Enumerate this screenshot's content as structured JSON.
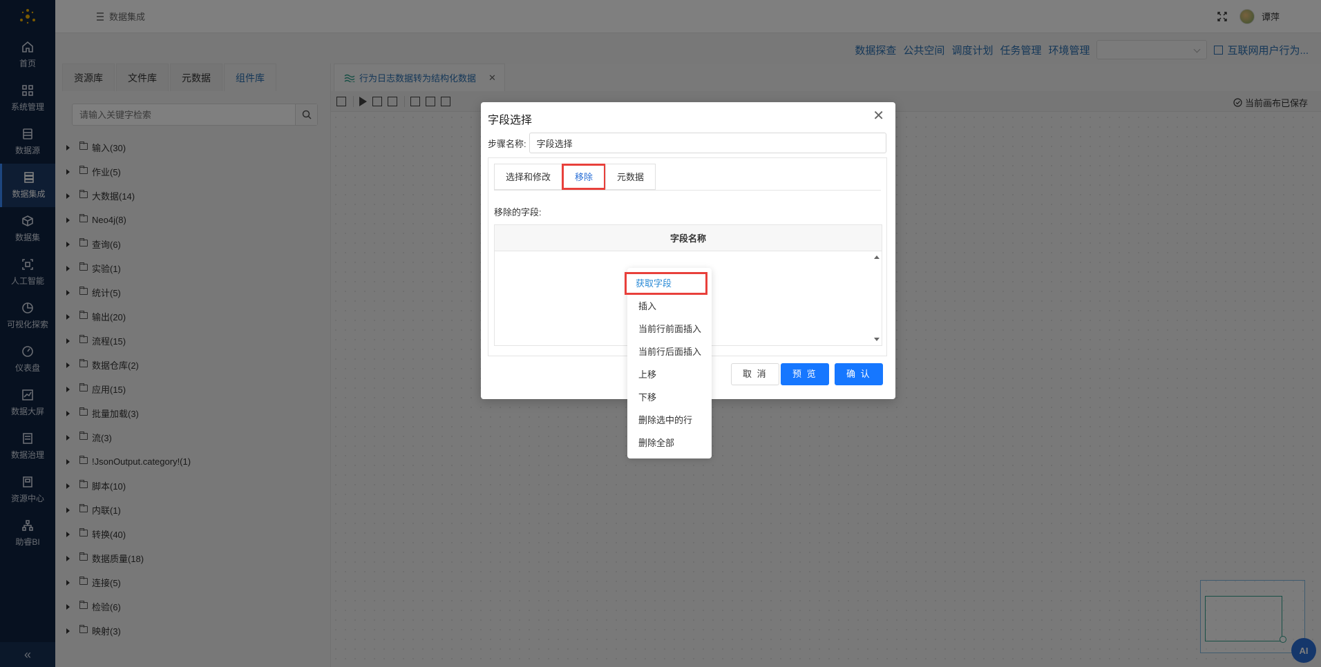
{
  "nav": {
    "items": [
      {
        "label": "首页",
        "icon": "home-icon"
      },
      {
        "label": "系统管理",
        "icon": "grid-icon"
      },
      {
        "label": "数据源",
        "icon": "database-icon"
      },
      {
        "label": "数据集成",
        "icon": "server-icon",
        "active": true
      },
      {
        "label": "数据集",
        "icon": "cube-icon"
      },
      {
        "label": "人工智能",
        "icon": "ai-scan-icon"
      },
      {
        "label": "可视化探索",
        "icon": "pie-chart-icon"
      },
      {
        "label": "仪表盘",
        "icon": "gauge-icon"
      },
      {
        "label": "数据大屏",
        "icon": "line-chart-icon"
      },
      {
        "label": "数据治理",
        "icon": "document-icon"
      },
      {
        "label": "资源中心",
        "icon": "book-icon"
      },
      {
        "label": "助睿BI",
        "icon": "network-icon"
      }
    ],
    "collapse": "«"
  },
  "header": {
    "breadcrumb": "数据集成",
    "username": "谭萍"
  },
  "toplinks": {
    "items": [
      "数据探查",
      "公共空间",
      "调度计划",
      "任务管理",
      "环境管理"
    ],
    "project": "互联网用户行为..."
  },
  "leftpanel": {
    "tabs": [
      "资源库",
      "文件库",
      "元数据",
      "组件库"
    ],
    "active_tab": 3,
    "search_placeholder": "请输入关键字检索",
    "tree": [
      "输入(30)",
      "作业(5)",
      "大数据(14)",
      "Neo4j(8)",
      "查询(6)",
      "实验(1)",
      "统计(5)",
      "输出(20)",
      "流程(15)",
      "数据仓库(2)",
      "应用(15)",
      "批量加载(3)",
      "流(3)",
      "!JsonOutput.category!(1)",
      "脚本(10)",
      "内联(1)",
      "转换(40)",
      "数据质量(18)",
      "连接(5)",
      "检验(6)",
      "映射(3)"
    ]
  },
  "workarea": {
    "doc_tab": "行为日志数据转为结构化数据",
    "saved_status": "当前画布已保存",
    "ai_label": "AI"
  },
  "dialog": {
    "title": "字段选择",
    "step_label": "步骤名称:",
    "step_value": "字段选择",
    "tabs": [
      "选择和修改",
      "移除",
      "元数据"
    ],
    "active_tab": 1,
    "remove_label": "移除的字段:",
    "column_header": "字段名称",
    "cancel": "取 消",
    "preview": "预 览",
    "confirm": "确 认"
  },
  "context_menu": {
    "items": [
      "获取字段",
      "插入",
      "当前行前面插入",
      "当前行后面插入",
      "上移",
      "下移",
      "删除选中的行",
      "删除全部"
    ],
    "highlighted": 0
  },
  "colors": {
    "nav_bg": "#0f2341",
    "accent": "#1677ff",
    "link": "#2a6fb0",
    "highlight_box": "#e8403b"
  }
}
